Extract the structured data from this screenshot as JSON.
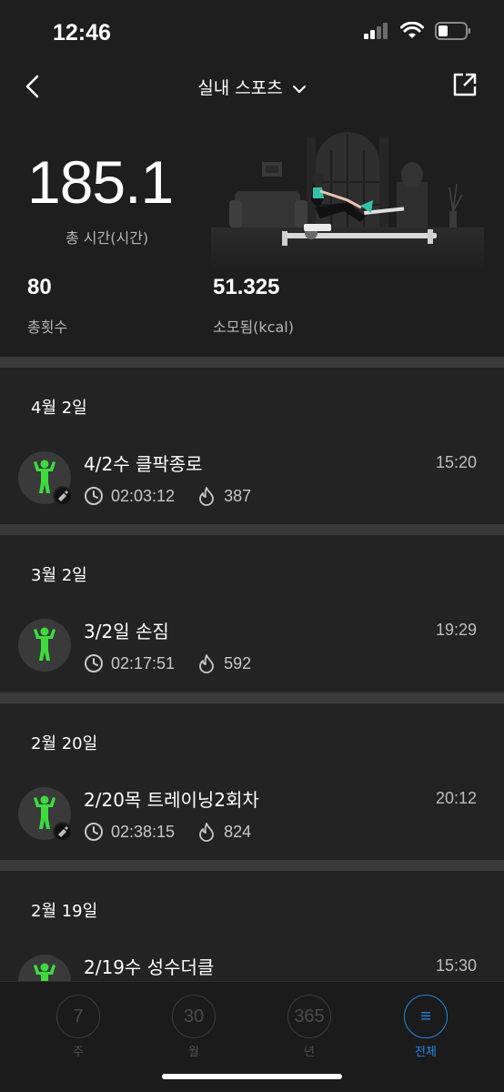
{
  "status_bar": {
    "time": "12:46"
  },
  "nav": {
    "title": "실내 스포츠"
  },
  "summary": {
    "total_time_value": "185.1",
    "total_time_label": "총 시간(시간)",
    "count_value": "80",
    "count_label": "총횟수",
    "calories_value": "51.325",
    "calories_label": "소모됨(kcal)"
  },
  "days": [
    {
      "date": "4월 2일",
      "title": "4/2수 클팍종로",
      "time": "15:20",
      "duration": "02:03:12",
      "calories": "387",
      "badge": true
    },
    {
      "date": "3월 2일",
      "title": "3/2일 손짐",
      "time": "19:29",
      "duration": "02:17:51",
      "calories": "592",
      "badge": false
    },
    {
      "date": "2월 20일",
      "title": "2/20목 트레이닝2회차",
      "time": "20:12",
      "duration": "02:38:15",
      "calories": "824",
      "badge": true
    },
    {
      "date": "2월 19일",
      "title": "2/19수 성수더클",
      "time": "15:30",
      "duration": "",
      "calories": "",
      "badge": false
    }
  ],
  "tabs": [
    {
      "number": "7",
      "label": "주"
    },
    {
      "number": "30",
      "label": "월"
    },
    {
      "number": "365",
      "label": "년"
    },
    {
      "number": "≡",
      "label": "전체"
    }
  ],
  "colors": {
    "accent": "#1e88e5",
    "figure": "#3ddc3d",
    "background": "#1e1e1e",
    "card": "#232323",
    "divider": "#3a3a3a"
  }
}
